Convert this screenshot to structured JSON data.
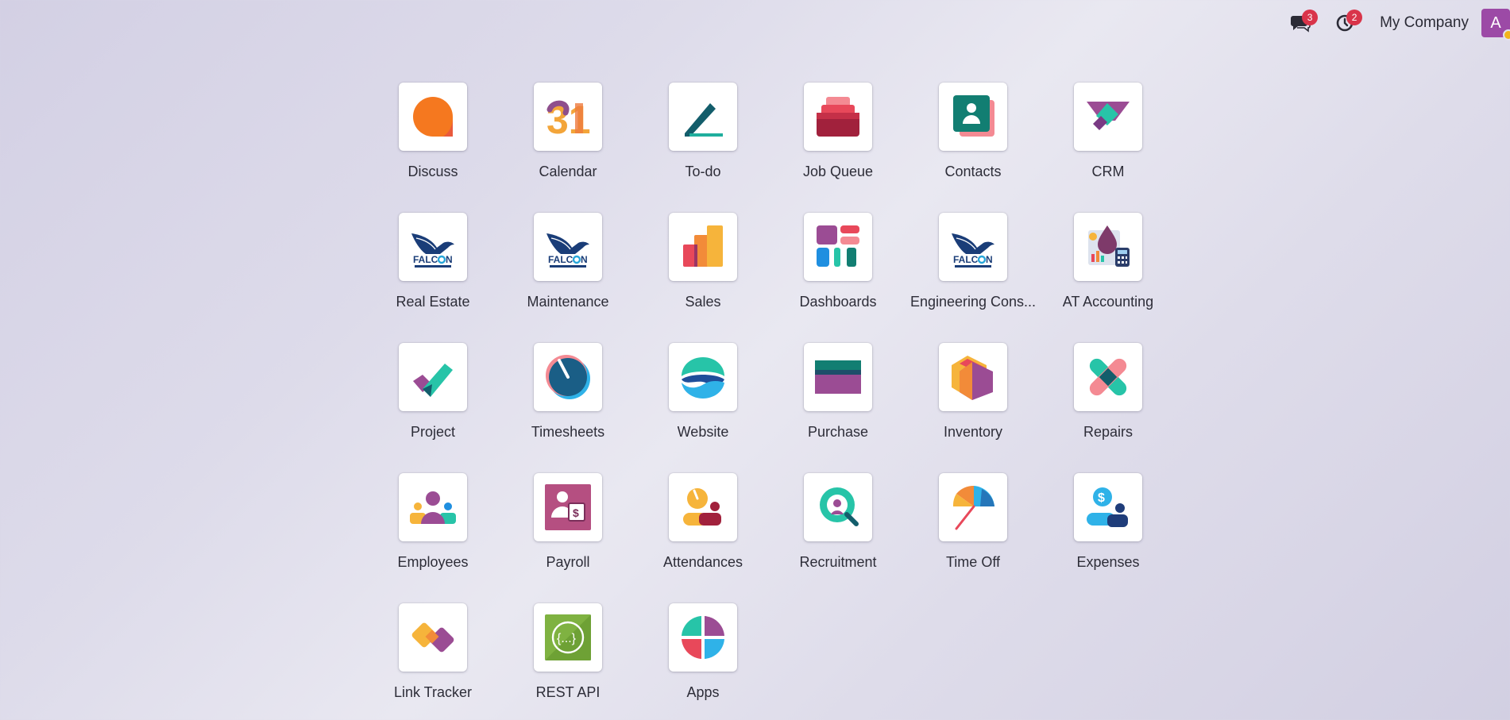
{
  "topbar": {
    "messages_badge": "3",
    "activity_badge": "2",
    "company": "My Company",
    "avatar_letter": "A"
  },
  "apps": [
    {
      "label": "Discuss",
      "icon": "discuss-icon"
    },
    {
      "label": "Calendar",
      "icon": "calendar-icon",
      "glyph": "31"
    },
    {
      "label": "To-do",
      "icon": "todo-icon"
    },
    {
      "label": "Job Queue",
      "icon": "job-queue-icon"
    },
    {
      "label": "Contacts",
      "icon": "contacts-icon"
    },
    {
      "label": "CRM",
      "icon": "crm-icon"
    },
    {
      "label": "Real Estate",
      "icon": "falcon-logo-icon"
    },
    {
      "label": "Maintenance",
      "icon": "falcon-logo-icon"
    },
    {
      "label": "Sales",
      "icon": "sales-icon"
    },
    {
      "label": "Dashboards",
      "icon": "dashboards-icon"
    },
    {
      "label": "Engineering Cons...",
      "icon": "falcon-logo-icon"
    },
    {
      "label": "AT Accounting",
      "icon": "accounting-icon"
    },
    {
      "label": "Project",
      "icon": "project-icon"
    },
    {
      "label": "Timesheets",
      "icon": "timesheets-icon"
    },
    {
      "label": "Website",
      "icon": "website-icon"
    },
    {
      "label": "Purchase",
      "icon": "purchase-icon"
    },
    {
      "label": "Inventory",
      "icon": "inventory-icon"
    },
    {
      "label": "Repairs",
      "icon": "repairs-icon"
    },
    {
      "label": "Employees",
      "icon": "employees-icon"
    },
    {
      "label": "Payroll",
      "icon": "payroll-icon"
    },
    {
      "label": "Attendances",
      "icon": "attendances-icon"
    },
    {
      "label": "Recruitment",
      "icon": "recruitment-icon"
    },
    {
      "label": "Time Off",
      "icon": "time-off-icon"
    },
    {
      "label": "Expenses",
      "icon": "expenses-icon"
    },
    {
      "label": "Link Tracker",
      "icon": "link-tracker-icon"
    },
    {
      "label": "REST API",
      "icon": "rest-api-icon",
      "glyph": "{...}"
    },
    {
      "label": "Apps",
      "icon": "apps-icon"
    }
  ],
  "colors": {
    "badge": "#d9344a",
    "avatar": "#9c4aa6",
    "avatar_status": "#f2b41c"
  }
}
